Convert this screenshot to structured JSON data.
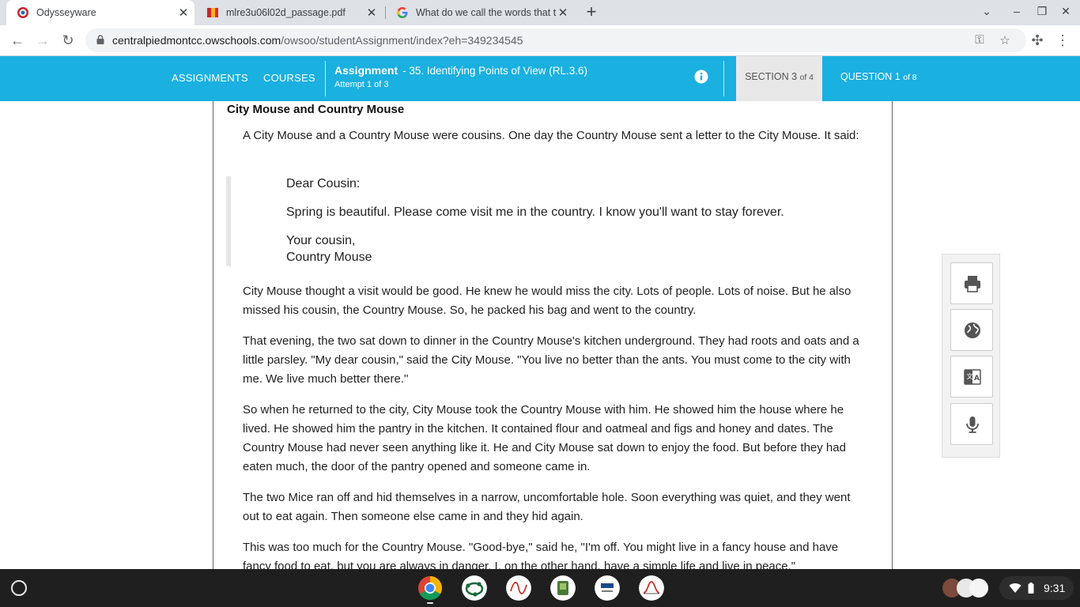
{
  "browser": {
    "tabs": [
      {
        "title": "Odysseyware",
        "favicon": "odysseyware-icon"
      },
      {
        "title": "mlre3u06l02d_passage.pdf",
        "favicon": "pdf-icon"
      },
      {
        "title": "What do we call the words that t",
        "favicon": "google-icon"
      }
    ],
    "url_host": "centralpiedmontcc.owschools.com",
    "url_path": "/owsoo/studentAssignment/index?eh=349234545"
  },
  "header": {
    "nav": [
      "ASSIGNMENTS",
      "COURSES"
    ],
    "assignment_label": "Assignment",
    "assignment_name": "- 35. Identifying Points of View (RL.3.6)",
    "attempt": "Attempt 1 of 3",
    "section_prefix": "SECTION 3",
    "section_suffix": "of 4",
    "question_prefix": "QUESTION 1",
    "question_suffix": "of 8"
  },
  "passage": {
    "title": "City Mouse and Country Mouse",
    "intro": "A City Mouse and a Country Mouse were cousins. One day the Country Mouse sent a letter to the City Mouse. It said:",
    "letter": {
      "greeting": "Dear Cousin:",
      "body": "Spring is beautiful. Please come visit me in the country. I know you'll want to stay forever.",
      "closing": "Your cousin,",
      "signature": "Country Mouse"
    },
    "paragraphs": [
      "City Mouse thought a visit would be good. He knew he would miss the city. Lots of people. Lots of noise. But he also missed his cousin, the Country Mouse. So, he packed his bag and went to the country.",
      "That evening, the two sat down to dinner in the Country Mouse's kitchen underground. They had roots and oats and a little parsley. \"My dear cousin,\" said the City Mouse. \"You live no better than the ants. You must come to the city with me. We live much better there.\"",
      "So when he returned to the city, City Mouse took the Country Mouse with him. He showed him the house where he lived. He showed him the pantry in the kitchen. It contained flour and oatmeal and figs and honey and dates. The Country Mouse had never seen anything like it. He and City Mouse sat down to enjoy the food. But before they had eaten much, the door of the pantry opened and someone came in.",
      "The two Mice ran off and hid themselves in a narrow, uncomfortable hole. Soon everything was quiet, and they went out to eat again. Then someone else came in and they hid again.",
      "This was too much for the Country Mouse. \"Good-bye,\" said he, \"I'm off. You might live in a fancy house and have fancy food to eat, but you are always in danger. I, on the other hand, have a simple life and live in peace.\""
    ]
  },
  "tools": [
    "print-icon",
    "globe-icon",
    "translate-icon",
    "microphone-icon"
  ],
  "taskbar": {
    "apps": [
      "chrome-icon",
      "geogebra-icon",
      "desmos-icon",
      "evernote-icon",
      "pearson-techbar-icon",
      "analytics-icon"
    ],
    "time": "9:31"
  }
}
